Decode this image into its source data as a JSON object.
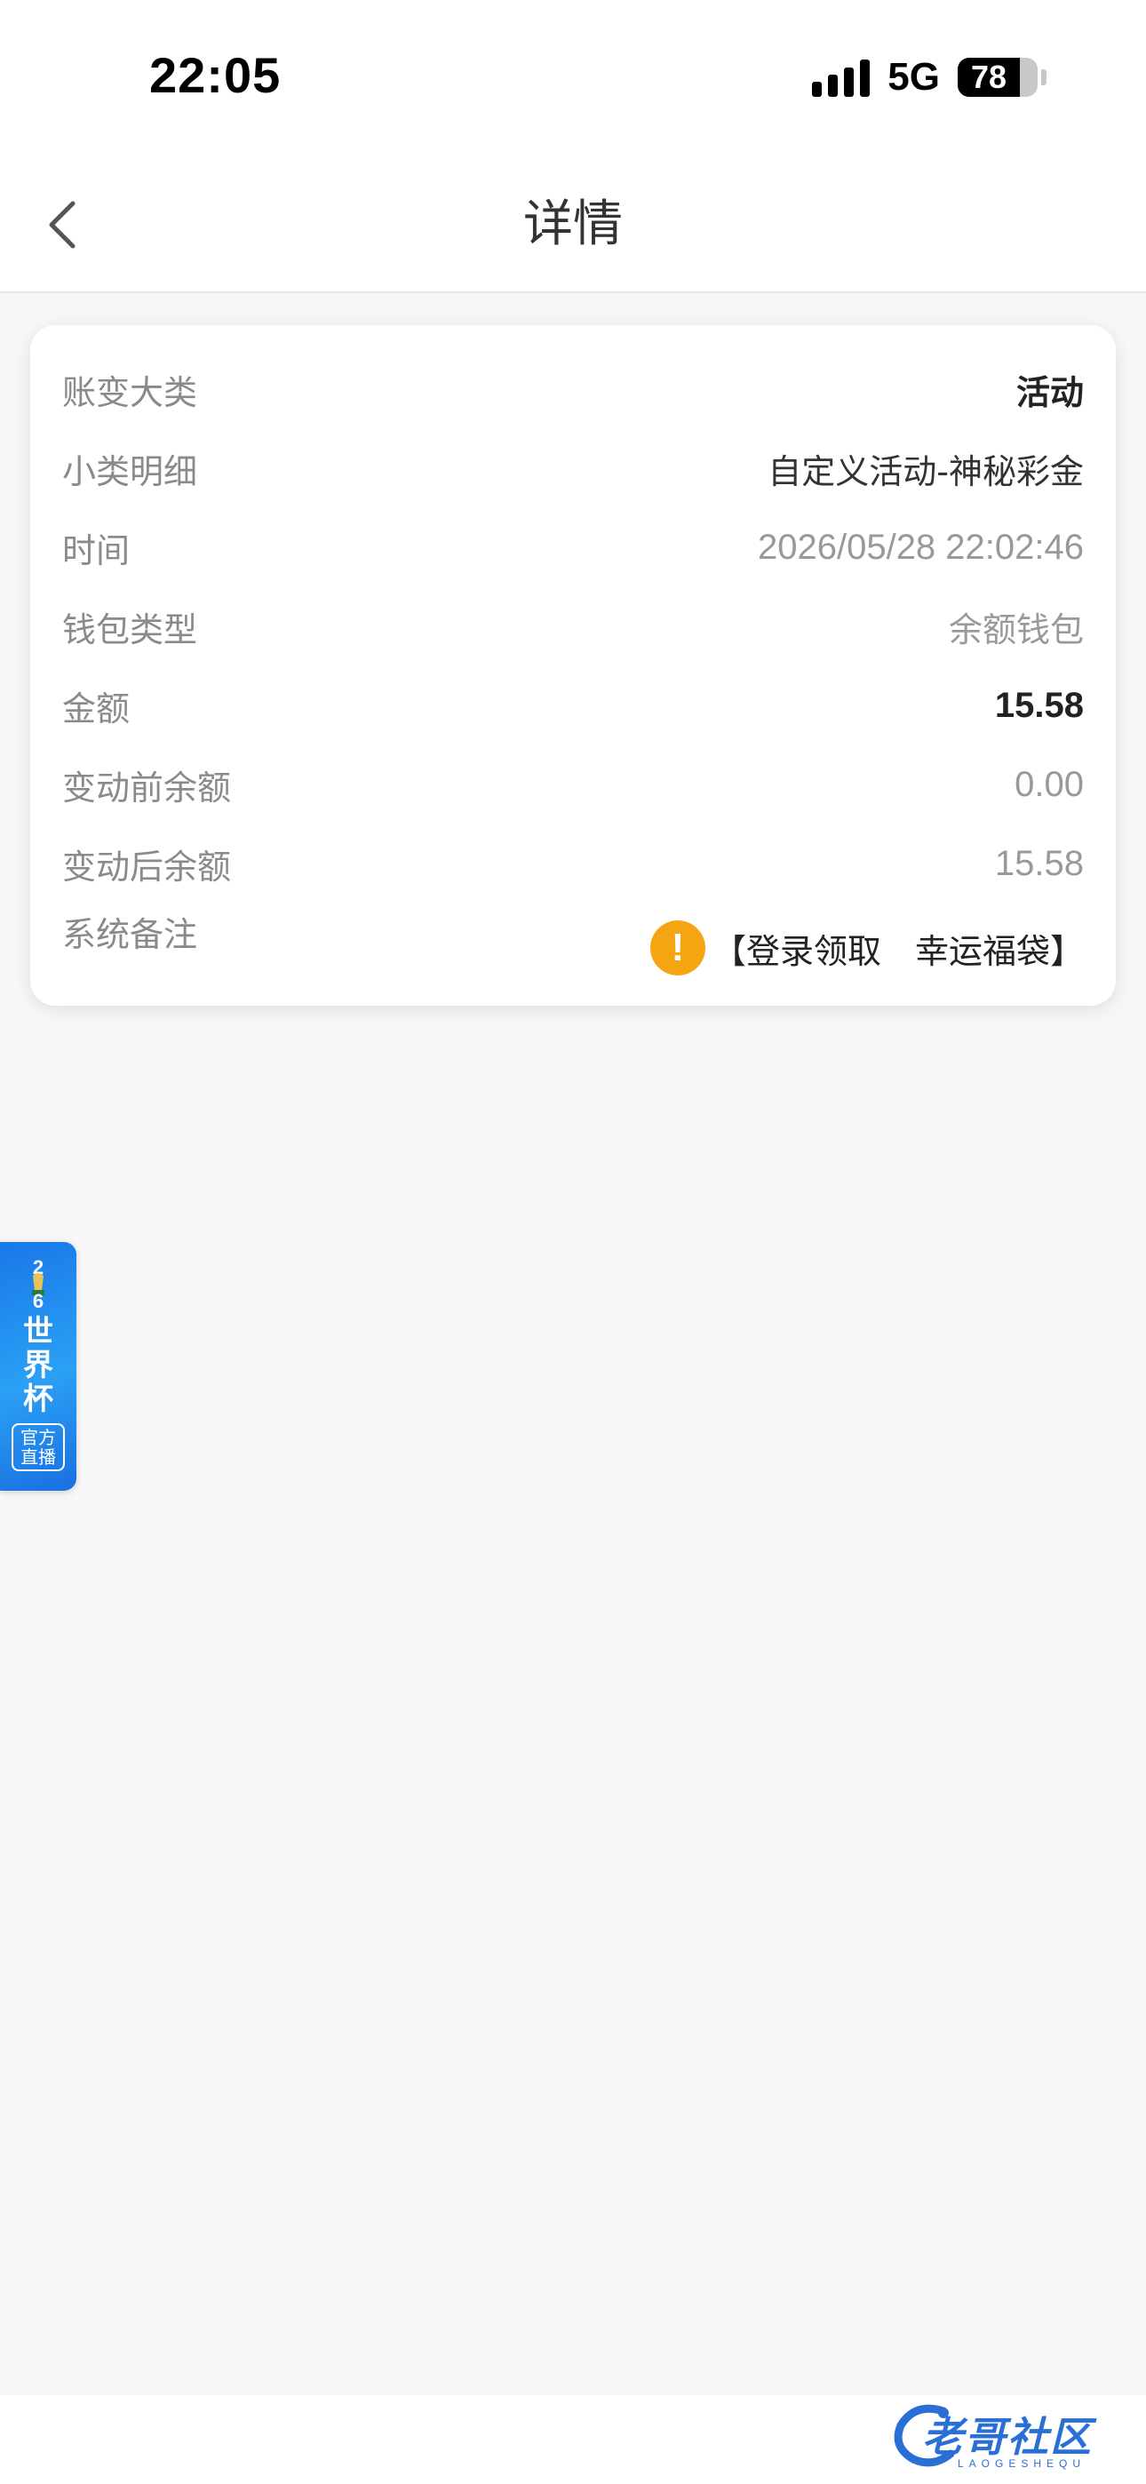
{
  "status_bar": {
    "time": "22:05",
    "network": "5G",
    "battery": "78",
    "battery_level_percent": 78,
    "signal_bars": 4
  },
  "nav": {
    "title": "详情",
    "back_icon": "chevron-left-icon"
  },
  "details": {
    "rows": [
      {
        "label": "账变大类",
        "value": "活动"
      },
      {
        "label": "小类明细",
        "value": "自定义活动-神秘彩金"
      },
      {
        "label": "时间",
        "value": "2026/05/28 22:02:46"
      },
      {
        "label": "钱包类型",
        "value": "余额钱包"
      },
      {
        "label": "金额",
        "value": "15.58"
      },
      {
        "label": "变动前余额",
        "value": "0.00"
      },
      {
        "label": "变动后余额",
        "value": "15.58"
      },
      {
        "label": "系统备注",
        "value": "【登录领取　幸运福袋】",
        "icon": "warning-icon"
      }
    ]
  },
  "world_cup_badge": {
    "logo_text": "26",
    "title": "世界杯",
    "subtitle": "官方直播"
  },
  "watermark": {
    "text": "老哥社区",
    "sub": "LAOGESHEQU"
  },
  "colors": {
    "warning": "#f5a512",
    "badge_blue": "#1a78e8",
    "background": "#f7f7f7"
  }
}
